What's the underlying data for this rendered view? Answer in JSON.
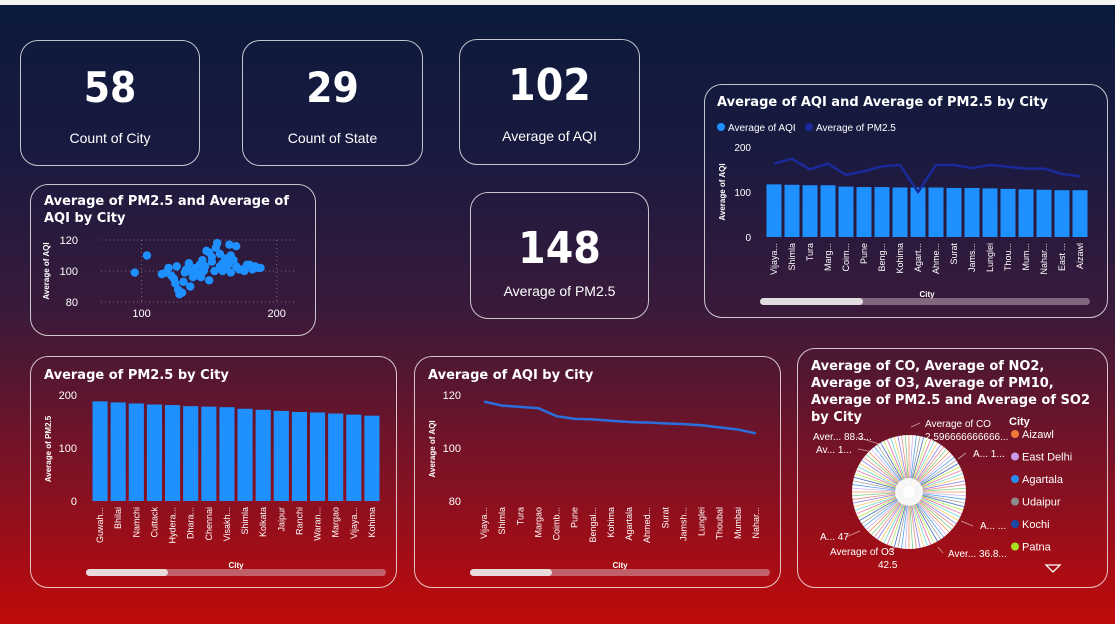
{
  "kpis": {
    "count_city": {
      "value": "58",
      "label": "Count of City"
    },
    "count_state": {
      "value": "29",
      "label": "Count of State"
    },
    "avg_aqi": {
      "value": "102",
      "label": "Average of AQI"
    },
    "avg_pm25": {
      "value": "148",
      "label": "Average of PM2.5"
    }
  },
  "colors": {
    "bar": "#1e90ff",
    "line2": "#1a2a9a",
    "line": "#2a6fdc"
  },
  "chart_data": [
    {
      "id": "combo",
      "type": "bar",
      "title": "Average of AQI and Average of PM2.5 by City",
      "legend": [
        "Average of AQI",
        "Average of PM2.5"
      ],
      "xlabel": "City",
      "ylabel": "Average of AQI",
      "yticks": [
        "200",
        "100",
        "0"
      ],
      "ylim": [
        0,
        200
      ],
      "categories": [
        "Vijaya...",
        "Shimla",
        "Tura",
        "Marg...",
        "Coim...",
        "Pune",
        "Beng...",
        "Kohima",
        "Agart...",
        "Ahme...",
        "Surat",
        "Jams...",
        "Lunglei",
        "Thou...",
        "Mum...",
        "Nahar...",
        "East ...",
        "Aizawl"
      ],
      "series": [
        {
          "name": "Average of AQI",
          "values": [
            117,
            116,
            115,
            115,
            112,
            111,
            111,
            110,
            110,
            110,
            109,
            109,
            108,
            107,
            106,
            105,
            104,
            104
          ]
        },
        {
          "name": "Average of PM2.5",
          "values": [
            163,
            174,
            150,
            163,
            138,
            146,
            157,
            160,
            100,
            160,
            160,
            153,
            160,
            156,
            152,
            152,
            140,
            135
          ]
        }
      ]
    },
    {
      "id": "scatter",
      "type": "scatter",
      "title": "Average of PM2.5 and Average of AQI by City",
      "xlabel": "",
      "ylabel": "Average of AQI",
      "xticks": [
        "100",
        "200"
      ],
      "yticks": [
        "120",
        "100",
        "80"
      ],
      "xlim": [
        70,
        215
      ],
      "ylim": [
        80,
        120
      ],
      "points": [
        [
          95,
          99
        ],
        [
          104,
          110
        ],
        [
          115,
          98
        ],
        [
          120,
          102
        ],
        [
          122,
          97
        ],
        [
          124,
          95
        ],
        [
          125,
          92
        ],
        [
          127,
          88
        ],
        [
          128,
          85
        ],
        [
          130,
          86
        ],
        [
          131,
          93
        ],
        [
          132,
          99
        ],
        [
          133,
          101
        ],
        [
          135,
          105
        ],
        [
          136,
          100
        ],
        [
          138,
          96
        ],
        [
          140,
          97
        ],
        [
          140,
          102
        ],
        [
          142,
          98
        ],
        [
          143,
          104
        ],
        [
          145,
          107
        ],
        [
          146,
          100
        ],
        [
          147,
          103
        ],
        [
          148,
          113
        ],
        [
          150,
          112
        ],
        [
          152,
          109
        ],
        [
          154,
          100
        ],
        [
          155,
          115
        ],
        [
          156,
          118
        ],
        [
          158,
          111
        ],
        [
          160,
          105
        ],
        [
          160,
          100
        ],
        [
          162,
          102
        ],
        [
          164,
          104
        ],
        [
          165,
          117
        ],
        [
          166,
          110
        ],
        [
          168,
          107
        ],
        [
          170,
          103
        ],
        [
          172,
          101
        ],
        [
          174,
          101
        ],
        [
          176,
          100
        ],
        [
          178,
          104
        ],
        [
          180,
          104
        ],
        [
          182,
          101
        ],
        [
          184,
          103
        ],
        [
          186,
          102
        ],
        [
          188,
          102
        ],
        [
          144,
          96
        ],
        [
          150,
          94
        ],
        [
          136,
          90
        ],
        [
          126,
          103
        ],
        [
          118,
          99
        ],
        [
          162,
          108
        ],
        [
          170,
          116
        ],
        [
          152,
          106
        ],
        [
          146,
          101
        ],
        [
          158,
          103
        ],
        [
          166,
          99
        ]
      ]
    },
    {
      "id": "pm25bar",
      "type": "bar",
      "title": "Average of PM2.5 by City",
      "xlabel": "City",
      "ylabel": "Average of PM2.5",
      "yticks": [
        "200",
        "100",
        "0"
      ],
      "ylim": [
        0,
        200
      ],
      "categories": [
        "Guwah...",
        "Bhilai",
        "Namchi",
        "Cuttack",
        "Hydera...",
        "Dhara...",
        "Chennai",
        "Visakh...",
        "Shimla",
        "Kolkata",
        "Jaipur",
        "Ranchi",
        "Waran...",
        "Margao",
        "Vijaya...",
        "Kohima"
      ],
      "values": [
        188,
        186,
        184,
        182,
        181,
        179,
        178,
        177,
        174,
        172,
        170,
        168,
        167,
        165,
        163,
        161
      ]
    },
    {
      "id": "aqiline",
      "type": "line",
      "title": "Average of AQI by City",
      "xlabel": "City",
      "ylabel": "Average of AQI",
      "yticks": [
        "120",
        "100",
        "80"
      ],
      "ylim": [
        80,
        120
      ],
      "categories": [
        "Vijaya...",
        "Shimla",
        "Tura",
        "Margao",
        "Coimb...",
        "Pune",
        "Bengal...",
        "Kohima",
        "Agartala",
        "Ahmed...",
        "Surat",
        "Jamsh...",
        "Lunglei",
        "Thoubal",
        "Mumbai",
        "Nahar..."
      ],
      "values": [
        117.5,
        116,
        115.5,
        115,
        112,
        111,
        110.8,
        110.3,
        109.8,
        109.6,
        109.3,
        109,
        108.6,
        107.8,
        107,
        105.5
      ]
    },
    {
      "id": "pie",
      "type": "pie",
      "title": "Average of CO, Average of NO2, Average of O3, Average of PM10, Average of PM2.5 and Average of SO2 by City",
      "legend_title": "City",
      "legend": [
        {
          "name": "Aizawl",
          "color": "#f07a3a"
        },
        {
          "name": "East Delhi",
          "color": "#c99ae8"
        },
        {
          "name": "Agartala",
          "color": "#2a8cf0"
        },
        {
          "name": "Udaipur",
          "color": "#8c8c8c"
        },
        {
          "name": "Kochi",
          "color": "#1a4aa8"
        },
        {
          "name": "Patna",
          "color": "#a8e020"
        }
      ],
      "labels": {
        "co_name": "Average of CO",
        "co_value": "2.596666666666...",
        "top_left_1": "Aver... 88.3...",
        "top_left_2": "Av... 1...",
        "right_1": "A... 1...",
        "right_2": "A... ...",
        "right_3": "Aver... 36.8...",
        "left_bottom": "A... 47",
        "o3_name": "Average of O3",
        "o3_value": "42.5"
      }
    }
  ]
}
